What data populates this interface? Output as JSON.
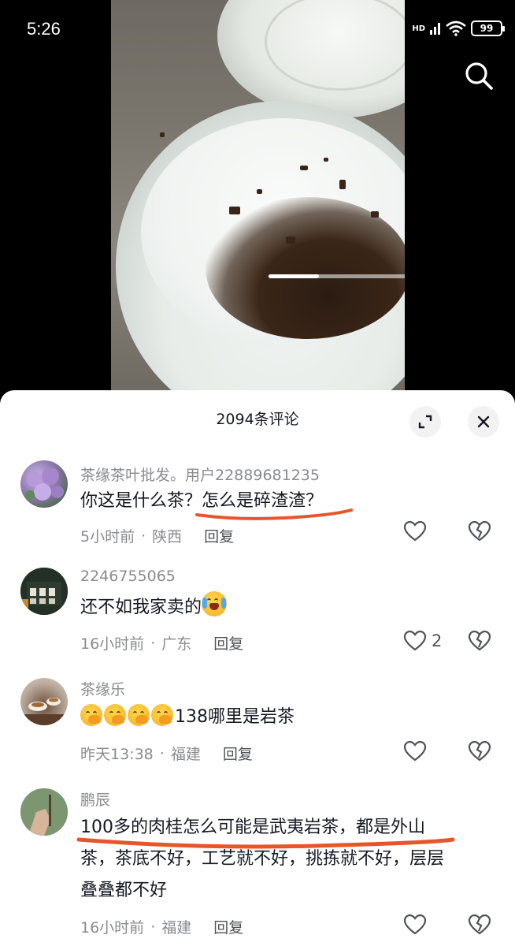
{
  "status_bar": {
    "time": "5:26",
    "battery": "99",
    "signal_label": "HD"
  },
  "video": {
    "progress_fraction": 0.27,
    "search_icon": "search-icon"
  },
  "comments_panel": {
    "title": "2094条评论",
    "expand_icon": "expand-icon",
    "close_icon": "close-icon"
  },
  "comments": [
    {
      "author": "茶缘茶叶批发。用户22889681235",
      "text": "你这是什么茶？怎么是碎渣渣？",
      "time": "5小时前",
      "location": "陕西",
      "reply": "回复",
      "likes": ""
    },
    {
      "author": "2246755065",
      "text": "还不如我家卖的",
      "emoji": "loudly-crying-face-emoji",
      "time": "16小时前",
      "location": "广东",
      "reply": "回复",
      "likes": "2"
    },
    {
      "author": "茶缘乐",
      "emoji": "shushing-face-emoji",
      "text": "138哪里是岩茶",
      "time": "昨天13:38",
      "location": "福建",
      "reply": "回复",
      "likes": ""
    },
    {
      "author": "鹏辰",
      "text_lines": [
        "100多的肉桂怎么可能是武夷岩茶，都是外山",
        "茶，茶底不好，工艺就不好，挑拣就不好，层层",
        "叠叠都不好"
      ],
      "time": "16小时前",
      "location": "福建",
      "reply": "回复",
      "likes": ""
    }
  ],
  "separator": "·",
  "colors": {
    "annotation_underline": "#e8552a",
    "secondary_text": "#8a8b91",
    "primary_text": "#161823"
  }
}
